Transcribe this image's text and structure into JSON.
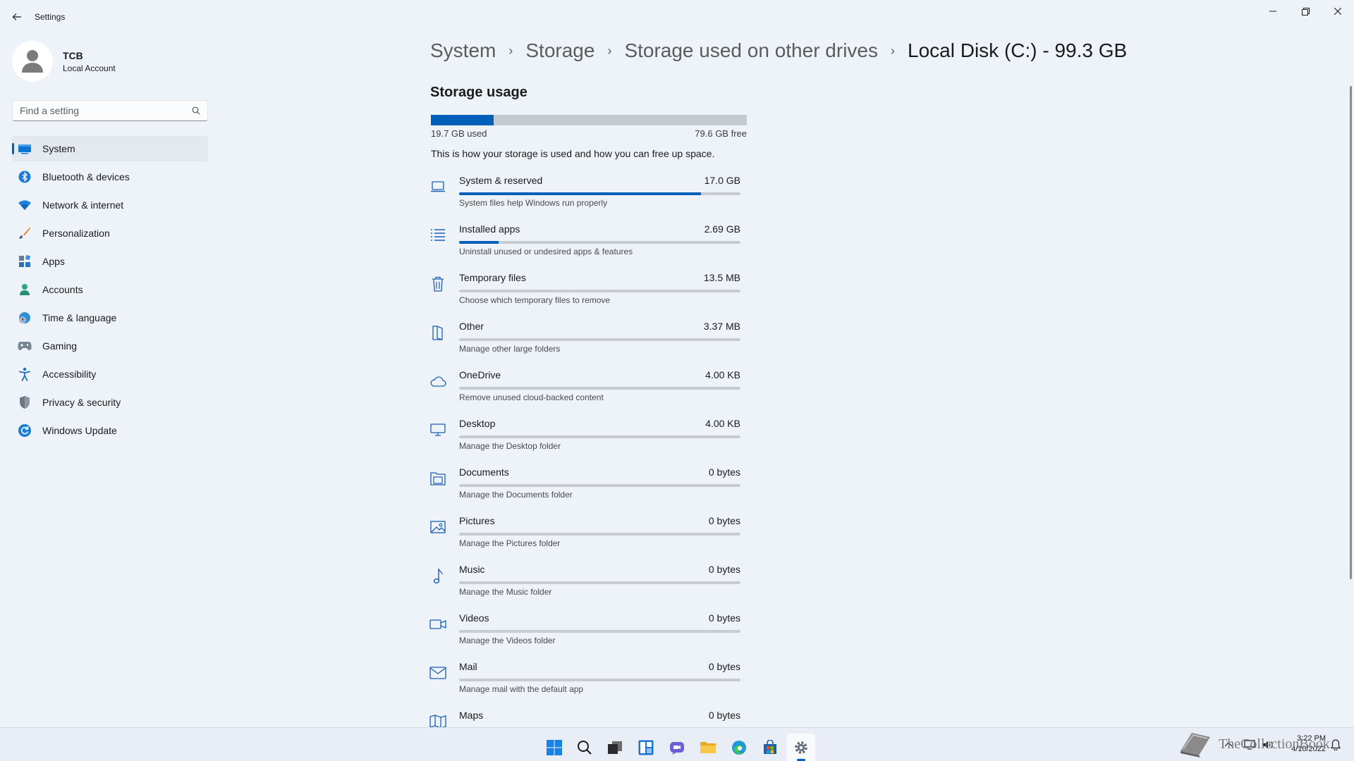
{
  "window": {
    "title": "Settings",
    "back_icon": "back-arrow-icon",
    "controls": [
      "minimize-icon",
      "restore-icon",
      "close-icon"
    ]
  },
  "profile": {
    "name": "TCB",
    "account_type": "Local Account"
  },
  "search": {
    "placeholder": "Find a setting",
    "value": ""
  },
  "sidebar": {
    "active": "System",
    "items": [
      {
        "label": "System",
        "icon": "system-icon"
      },
      {
        "label": "Bluetooth & devices",
        "icon": "bluetooth-icon"
      },
      {
        "label": "Network & internet",
        "icon": "wifi-icon"
      },
      {
        "label": "Personalization",
        "icon": "brush-icon"
      },
      {
        "label": "Apps",
        "icon": "apps-icon"
      },
      {
        "label": "Accounts",
        "icon": "person-icon"
      },
      {
        "label": "Time & language",
        "icon": "clock-globe-icon"
      },
      {
        "label": "Gaming",
        "icon": "gamepad-icon"
      },
      {
        "label": "Accessibility",
        "icon": "accessibility-icon"
      },
      {
        "label": "Privacy & security",
        "icon": "shield-icon"
      },
      {
        "label": "Windows Update",
        "icon": "update-icon"
      }
    ]
  },
  "breadcrumb": {
    "items": [
      "System",
      "Storage",
      "Storage used on other drives"
    ],
    "current": "Local Disk (C:) - 99.3 GB",
    "separator": "›"
  },
  "storage": {
    "section_title": "Storage usage",
    "used": "19.7 GB used",
    "free": "79.6 GB free",
    "used_fraction": 0.198,
    "description": "This is how your storage is used and how you can free up space.",
    "categories": [
      {
        "name": "System & reserved",
        "size": "17.0 GB",
        "subtitle": "System files help Windows run properly",
        "fraction": 0.86,
        "icon": "laptop-icon"
      },
      {
        "name": "Installed apps",
        "size": "2.69 GB",
        "subtitle": "Uninstall unused or undesired apps & features",
        "fraction": 0.14,
        "icon": "list-icon"
      },
      {
        "name": "Temporary files",
        "size": "13.5 MB",
        "subtitle": "Choose which temporary files to remove",
        "fraction": 0,
        "icon": "trash-icon"
      },
      {
        "name": "Other",
        "size": "3.37 MB",
        "subtitle": "Manage other large folders",
        "fraction": 0,
        "icon": "folder-open-icon"
      },
      {
        "name": "OneDrive",
        "size": "4.00 KB",
        "subtitle": "Remove unused cloud-backed content",
        "fraction": 0,
        "icon": "cloud-icon"
      },
      {
        "name": "Desktop",
        "size": "4.00 KB",
        "subtitle": "Manage the Desktop folder",
        "fraction": 0,
        "icon": "monitor-icon"
      },
      {
        "name": "Documents",
        "size": "0 bytes",
        "subtitle": "Manage the Documents folder",
        "fraction": 0,
        "icon": "documents-icon"
      },
      {
        "name": "Pictures",
        "size": "0 bytes",
        "subtitle": "Manage the Pictures folder",
        "fraction": 0,
        "icon": "image-icon"
      },
      {
        "name": "Music",
        "size": "0 bytes",
        "subtitle": "Manage the Music folder",
        "fraction": 0,
        "icon": "music-note-icon"
      },
      {
        "name": "Videos",
        "size": "0 bytes",
        "subtitle": "Manage the Videos folder",
        "fraction": 0,
        "icon": "video-camera-icon"
      },
      {
        "name": "Mail",
        "size": "0 bytes",
        "subtitle": "Manage mail with the default app",
        "fraction": 0,
        "icon": "mail-icon"
      },
      {
        "name": "Maps",
        "size": "0 bytes",
        "subtitle": "",
        "fraction": 0,
        "icon": "map-icon"
      }
    ]
  },
  "taskbar": {
    "apps": [
      "windows-start-icon",
      "search-icon",
      "task-view-icon",
      "widgets-icon",
      "chat-icon",
      "file-explorer-icon",
      "edge-icon",
      "store-icon",
      "settings-icon"
    ],
    "active_app": "settings-icon",
    "time": "3:22 PM",
    "date": "4/10/2022",
    "watermark": "TheCollectionBook"
  },
  "colors": {
    "accent": "#005fb8",
    "background": "#eef2f9",
    "bar_track": "#c8ccd2"
  }
}
